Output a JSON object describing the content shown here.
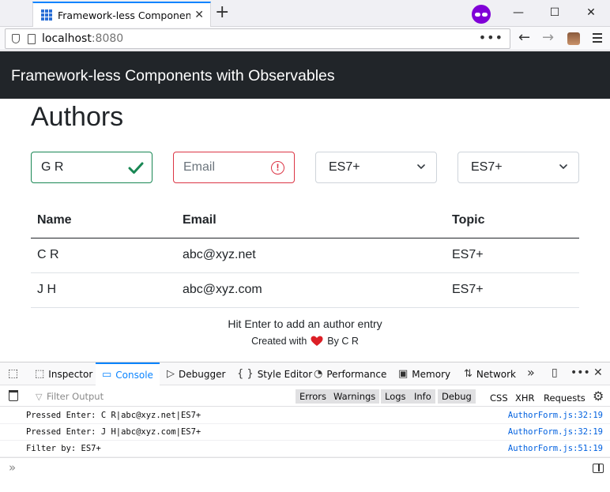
{
  "browser": {
    "tab_title": "Framework-less Components with Observables",
    "tab_close": "✕",
    "new_tab": "+",
    "url_host": "localhost",
    "url_port": ":8080",
    "url_more": "•••",
    "back": "←",
    "forward": "→",
    "minimize": "—",
    "maximize": "☐",
    "close": "✕",
    "accent": "#0a84ff",
    "private_color": "#8000d7"
  },
  "page": {
    "header_title": "Framework-less Components with Observables",
    "heading": "Authors",
    "form": {
      "name_value": "G R",
      "email_placeholder": "Email",
      "error_glyph": "!",
      "topic_select_1": "ES7+",
      "topic_select_2": "ES7+",
      "valid_color": "#198754",
      "invalid_color": "#dc3545"
    },
    "table": {
      "headers": [
        "Name",
        "Email",
        "Topic"
      ],
      "rows": [
        [
          "C R",
          "abc@xyz.net",
          "ES7+"
        ],
        [
          "J H",
          "abc@xyz.com",
          "ES7+"
        ]
      ]
    },
    "hint": "Hit Enter to add an author entry",
    "credits_before": "Created with",
    "credits_after": "By C R",
    "header_bg": "#212529"
  },
  "devtools": {
    "tabs": [
      "Inspector",
      "Console",
      "Debugger",
      "Style Editor",
      "Performance",
      "Memory",
      "Network"
    ],
    "tab_glyphs": [
      "⬚",
      "▭",
      "▷",
      "{ }",
      "◔",
      "▣",
      "⇅"
    ],
    "active_tab": "Console",
    "overflow": "»",
    "more": "•••",
    "close": "✕",
    "filter_placeholder": "Filter Output",
    "levels": [
      "Errors",
      "Warnings",
      "Logs",
      "Info",
      "Debug"
    ],
    "requests": [
      "CSS",
      "XHR",
      "Requests"
    ],
    "logs": [
      {
        "message": "Pressed Enter: C R|abc@xyz.net|ES7+",
        "source": "AuthorForm.js:32:19"
      },
      {
        "message": "Pressed Enter: J H|abc@xyz.com|ES7+",
        "source": "AuthorForm.js:32:19"
      },
      {
        "message": "Filter by: ES7+",
        "source": "AuthorForm.js:51:19"
      }
    ],
    "prompt": "»"
  }
}
